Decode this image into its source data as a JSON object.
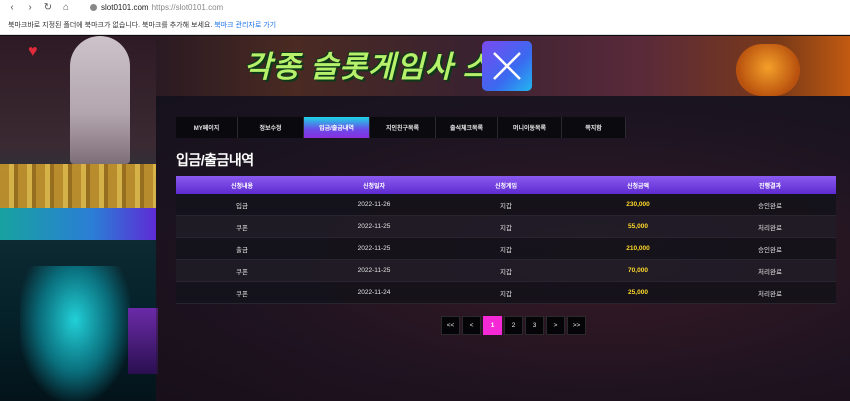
{
  "browser": {
    "domain": "slot0101.com",
    "url_path": "https://slot0101.com",
    "bookmark_message": "북마크바로 지정된 폴더에 북마크가 없습니다. 북마크를 추가해 보세요.",
    "bookmark_link": "북마크 관리자로 가기"
  },
  "banner": {
    "title": "각종 슬롯게임사      스!"
  },
  "tabs": [
    {
      "label": "MY페이지",
      "width": 62
    },
    {
      "label": "정보수정",
      "width": 66
    },
    {
      "label": "입금/출금내역",
      "width": 66
    },
    {
      "label": "지인친구목록",
      "width": 66
    },
    {
      "label": "출석체크목록",
      "width": 62
    },
    {
      "label": "머니이동목록",
      "width": 64
    },
    {
      "label": "쪽지함",
      "width": 64
    }
  ],
  "active_tab": 2,
  "section_title": "입금/출금내역",
  "table": {
    "headers": [
      "신청내용",
      "신청일자",
      "신청게임",
      "신청금액",
      "진행결과"
    ],
    "rows": [
      {
        "type": "입금",
        "date": "2022-11-26",
        "game": "지갑",
        "amount": "230,000",
        "result": "승인완료"
      },
      {
        "type": "쿠폰",
        "date": "2022-11-25",
        "game": "지갑",
        "amount": "55,000",
        "result": "처리완료"
      },
      {
        "type": "출금",
        "date": "2022-11-25",
        "game": "지갑",
        "amount": "210,000",
        "result": "승인완료"
      },
      {
        "type": "쿠폰",
        "date": "2022-11-25",
        "game": "지갑",
        "amount": "70,000",
        "result": "처리완료"
      },
      {
        "type": "쿠폰",
        "date": "2022-11-24",
        "game": "지갑",
        "amount": "25,000",
        "result": "처리완료"
      }
    ]
  },
  "pagination": {
    "first": "<<",
    "prev": "<",
    "pages": [
      "1",
      "2",
      "3"
    ],
    "current": "1",
    "next": ">",
    "last": ">>"
  },
  "colors": {
    "accent_purple": "#6a3ae0",
    "amount_yellow": "#ffd92a",
    "current_page_pink": "#f52ad6"
  }
}
